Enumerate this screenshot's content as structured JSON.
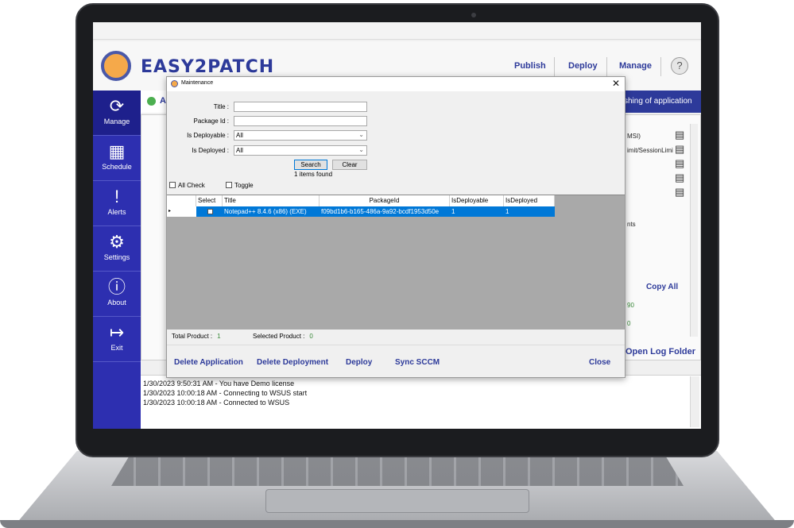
{
  "app": {
    "title": "EASY2PATCH",
    "top_nav": [
      "Publish",
      "Deploy",
      "Manage"
    ],
    "help_label": "?",
    "status_letter": "A",
    "banner_text": "shing of application"
  },
  "sidebar": {
    "items": [
      {
        "label": "Manage",
        "icon": "refresh-gear-icon",
        "glyph": "⟳"
      },
      {
        "label": "Schedule",
        "icon": "calendar-clock-icon",
        "glyph": "▦"
      },
      {
        "label": "Alerts",
        "icon": "alert-icon",
        "glyph": "!"
      },
      {
        "label": "Settings",
        "icon": "gear-icon",
        "glyph": "⚙"
      },
      {
        "label": "About",
        "icon": "info-icon",
        "glyph": "ⓘ"
      },
      {
        "label": "Exit",
        "icon": "exit-icon",
        "glyph": "↦"
      }
    ]
  },
  "background_panel": {
    "fragment1": "MSI)",
    "fragment2": "imit/SessionLimi",
    "fragment3": "nts",
    "fragment4": "90",
    "fragment5": "0",
    "copy_all": "Copy All",
    "open_log_folder": "Open Log Folder"
  },
  "log": {
    "lines": [
      "1/30/2023 9:50:31 AM - You have Demo license",
      "1/30/2023 10:00:18 AM - Connecting to WSUS start",
      "1/30/2023 10:00:18 AM - Connected to WSUS"
    ]
  },
  "dialog": {
    "title": "Maintenance",
    "close_glyph": "✕",
    "fields": {
      "title_label": "Title :",
      "title_value": "",
      "package_id_label": "Package Id :",
      "package_id_value": "",
      "is_deployable_label": "Is Deployable :",
      "is_deployable_value": "All",
      "is_deployed_label": "Is Deployed :",
      "is_deployed_value": "All"
    },
    "search_button": "Search",
    "clear_button": "Clear",
    "items_found": "1 items found",
    "all_check_label": "All Check",
    "toggle_label": "Toggle",
    "grid": {
      "columns": [
        "Select",
        "Title",
        "PackageId",
        "IsDeployable",
        "IsDeployed"
      ],
      "rows": [
        {
          "title": "Notepad++ 8.4.6 (x86) (EXE)",
          "package_id": "f09bd1b6-b165-486a-9a92-bcdf1953d50e",
          "is_deployable": "1",
          "is_deployed": "1"
        }
      ]
    },
    "total_product_label": "Total Product :",
    "total_product_value": "1",
    "selected_product_label": "Selected Product :",
    "selected_product_value": "0",
    "actions": [
      "Delete Application",
      "Delete Deployment",
      "Deploy",
      "Sync SCCM"
    ],
    "close_button": "Close"
  }
}
